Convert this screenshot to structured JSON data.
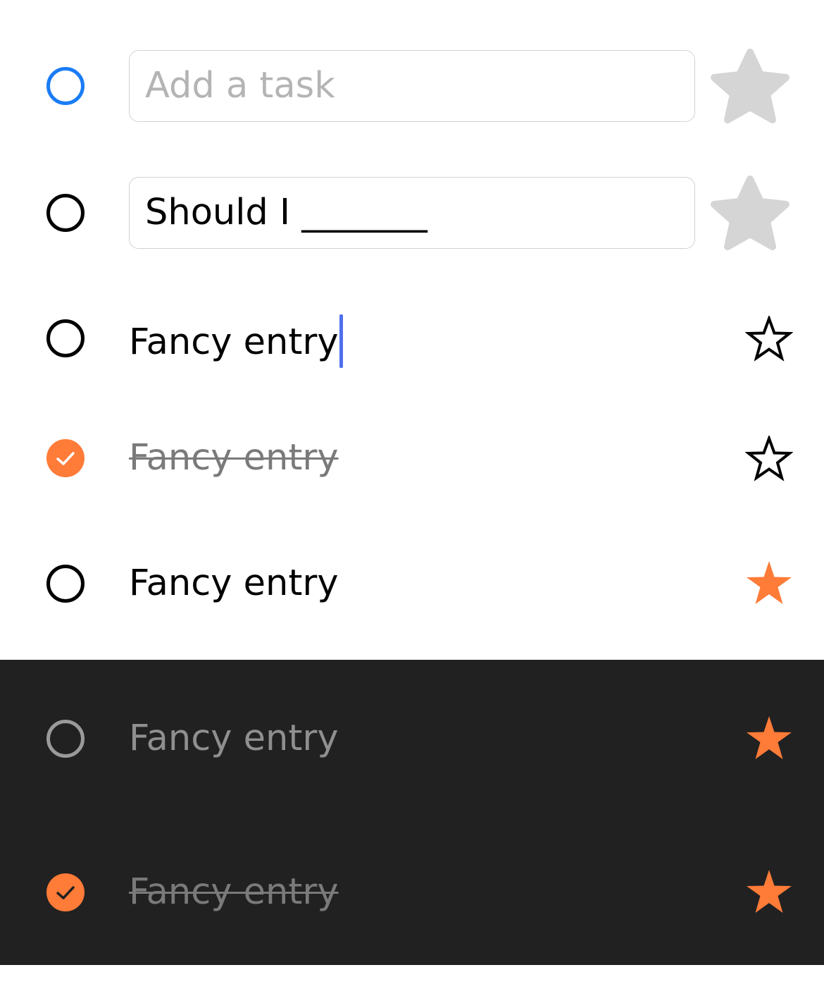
{
  "colors": {
    "accent_orange": "#ff7b38",
    "accent_blue": "#1a7cf5",
    "caret_blue": "#4f6ff0",
    "dark_background": "#212121",
    "placeholder_grey": "#b4b4b4",
    "inactive_star_grey": "#d5d5d5"
  },
  "rows": [
    {
      "kind": "input",
      "checkbox": "unchecked-blue",
      "placeholder": "Add a task",
      "value": "",
      "star": "inactive-filled-grey"
    },
    {
      "kind": "input",
      "checkbox": "unchecked",
      "placeholder": "",
      "value": "Should I _______",
      "star": "inactive-filled-grey"
    },
    {
      "kind": "editing",
      "checkbox": "unchecked",
      "label": "Fancy entry",
      "star": "outline"
    },
    {
      "kind": "item",
      "checkbox": "checked",
      "label": "Fancy entry",
      "completed": true,
      "star": "outline"
    },
    {
      "kind": "item",
      "checkbox": "unchecked",
      "label": "Fancy entry",
      "completed": false,
      "star": "filled-orange"
    }
  ],
  "dark_rows": [
    {
      "kind": "item",
      "checkbox": "unchecked-grey",
      "label": "Fancy entry",
      "completed": false,
      "star": "filled-orange"
    },
    {
      "kind": "item",
      "checkbox": "checked",
      "label": "Fancy entry",
      "completed": true,
      "star": "filled-orange"
    }
  ]
}
